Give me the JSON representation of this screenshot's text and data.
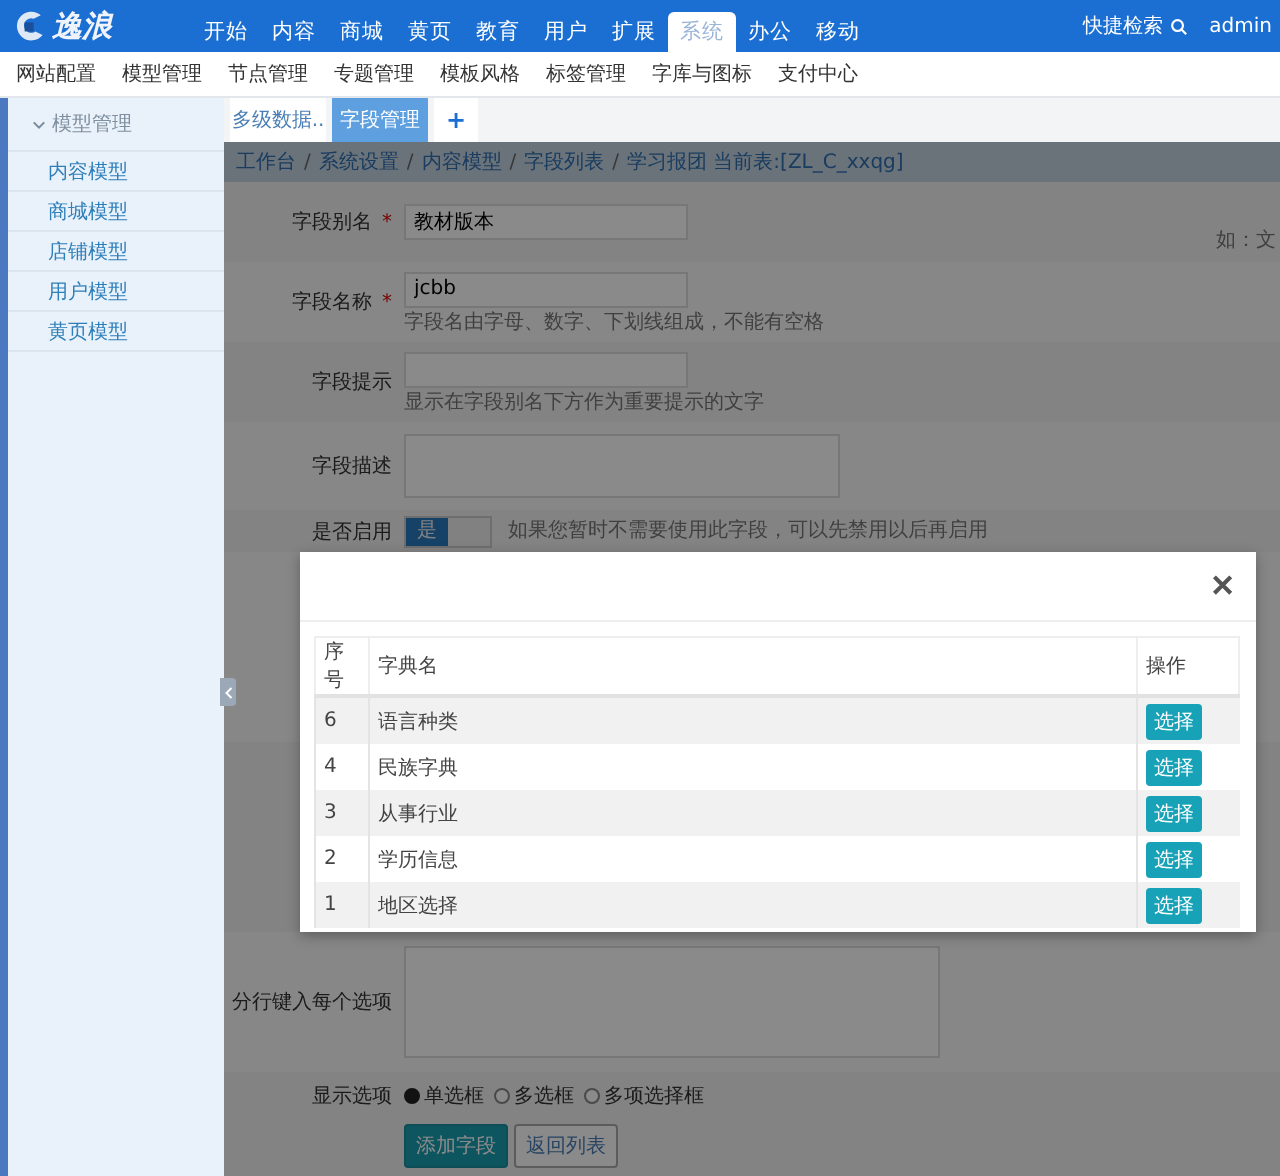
{
  "top_nav": {
    "logo": "逸浪",
    "items": [
      {
        "label": "开始",
        "selected": false
      },
      {
        "label": "内容",
        "selected": false
      },
      {
        "label": "商城",
        "selected": false
      },
      {
        "label": "黄页",
        "selected": false
      },
      {
        "label": "教育",
        "selected": false
      },
      {
        "label": "用户",
        "selected": false
      },
      {
        "label": "扩展",
        "selected": false
      },
      {
        "label": "系统",
        "selected": true
      },
      {
        "label": "办公",
        "selected": false
      },
      {
        "label": "移动",
        "selected": false
      }
    ],
    "search_label": "快捷检索",
    "user": "admin"
  },
  "sub_nav": [
    "网站配置",
    "模型管理",
    "节点管理",
    "专题管理",
    "模板风格",
    "标签管理",
    "字库与图标",
    "支付中心"
  ],
  "sidebar": {
    "group": {
      "label": "模型管理",
      "expanded": true
    },
    "items": [
      {
        "label": "内容模型",
        "selected": false
      },
      {
        "label": "商城模型",
        "selected": false
      },
      {
        "label": "店铺模型",
        "selected": false
      },
      {
        "label": "用户模型",
        "selected": false
      },
      {
        "label": "黄页模型",
        "selected": false
      }
    ]
  },
  "tabs": [
    {
      "label": "多级数据..",
      "selected": false
    },
    {
      "label": "字段管理",
      "selected": true
    }
  ],
  "add_tab": "+",
  "breadcrumb": [
    "工作台",
    "系统设置",
    "内容模型",
    "字段列表",
    "学习报团 当前表:[ZL_C_xxqg]"
  ],
  "breadcrumb_separator": "/",
  "form": {
    "required_mark": "*",
    "fields": [
      {
        "kind": "text",
        "label": "字段别名",
        "required": true,
        "value": "教材版本",
        "side_note": "如：文"
      },
      {
        "kind": "text",
        "label": "字段名称",
        "required": true,
        "value": "jcbb",
        "help": "字段名由字母、数字、下划线组成，不能有空格"
      },
      {
        "kind": "text",
        "label": "字段提示",
        "required": false,
        "help": "显示在字段别名下方作为重要提示的文字"
      },
      {
        "kind": "textarea",
        "label": "字段描述"
      },
      {
        "kind": "toggle",
        "label": "是否启用",
        "on": true,
        "on_label": "是",
        "help": "如果您暂时不需要使用此字段，可以先禁用以后再启用"
      },
      {
        "kind": "hidden"
      },
      {
        "kind": "hidden"
      },
      {
        "kind": "tall_textarea",
        "label": "分行键入每个选项"
      },
      {
        "kind": "radio",
        "label": "显示选项",
        "options": [
          {
            "label": "单选框",
            "selected": true
          },
          {
            "label": "多选框",
            "selected": false
          },
          {
            "label": "多项选择框",
            "selected": false
          }
        ]
      }
    ]
  },
  "buttons": [
    {
      "label": "添加字段",
      "kind": "primary"
    },
    {
      "label": "返回列表",
      "kind": "default"
    }
  ],
  "modal": {
    "close": "✕",
    "columns": [
      "序号",
      "字典名",
      "操作"
    ],
    "rows": [
      {
        "index": "6",
        "name": "语言种类",
        "action": "选择"
      },
      {
        "index": "4",
        "name": "民族字典",
        "action": "选择"
      },
      {
        "index": "3",
        "name": "从事行业",
        "action": "选择"
      },
      {
        "index": "2",
        "name": "学历信息",
        "action": "选择"
      },
      {
        "index": "1",
        "name": "地区选择",
        "action": "选择"
      }
    ]
  }
}
